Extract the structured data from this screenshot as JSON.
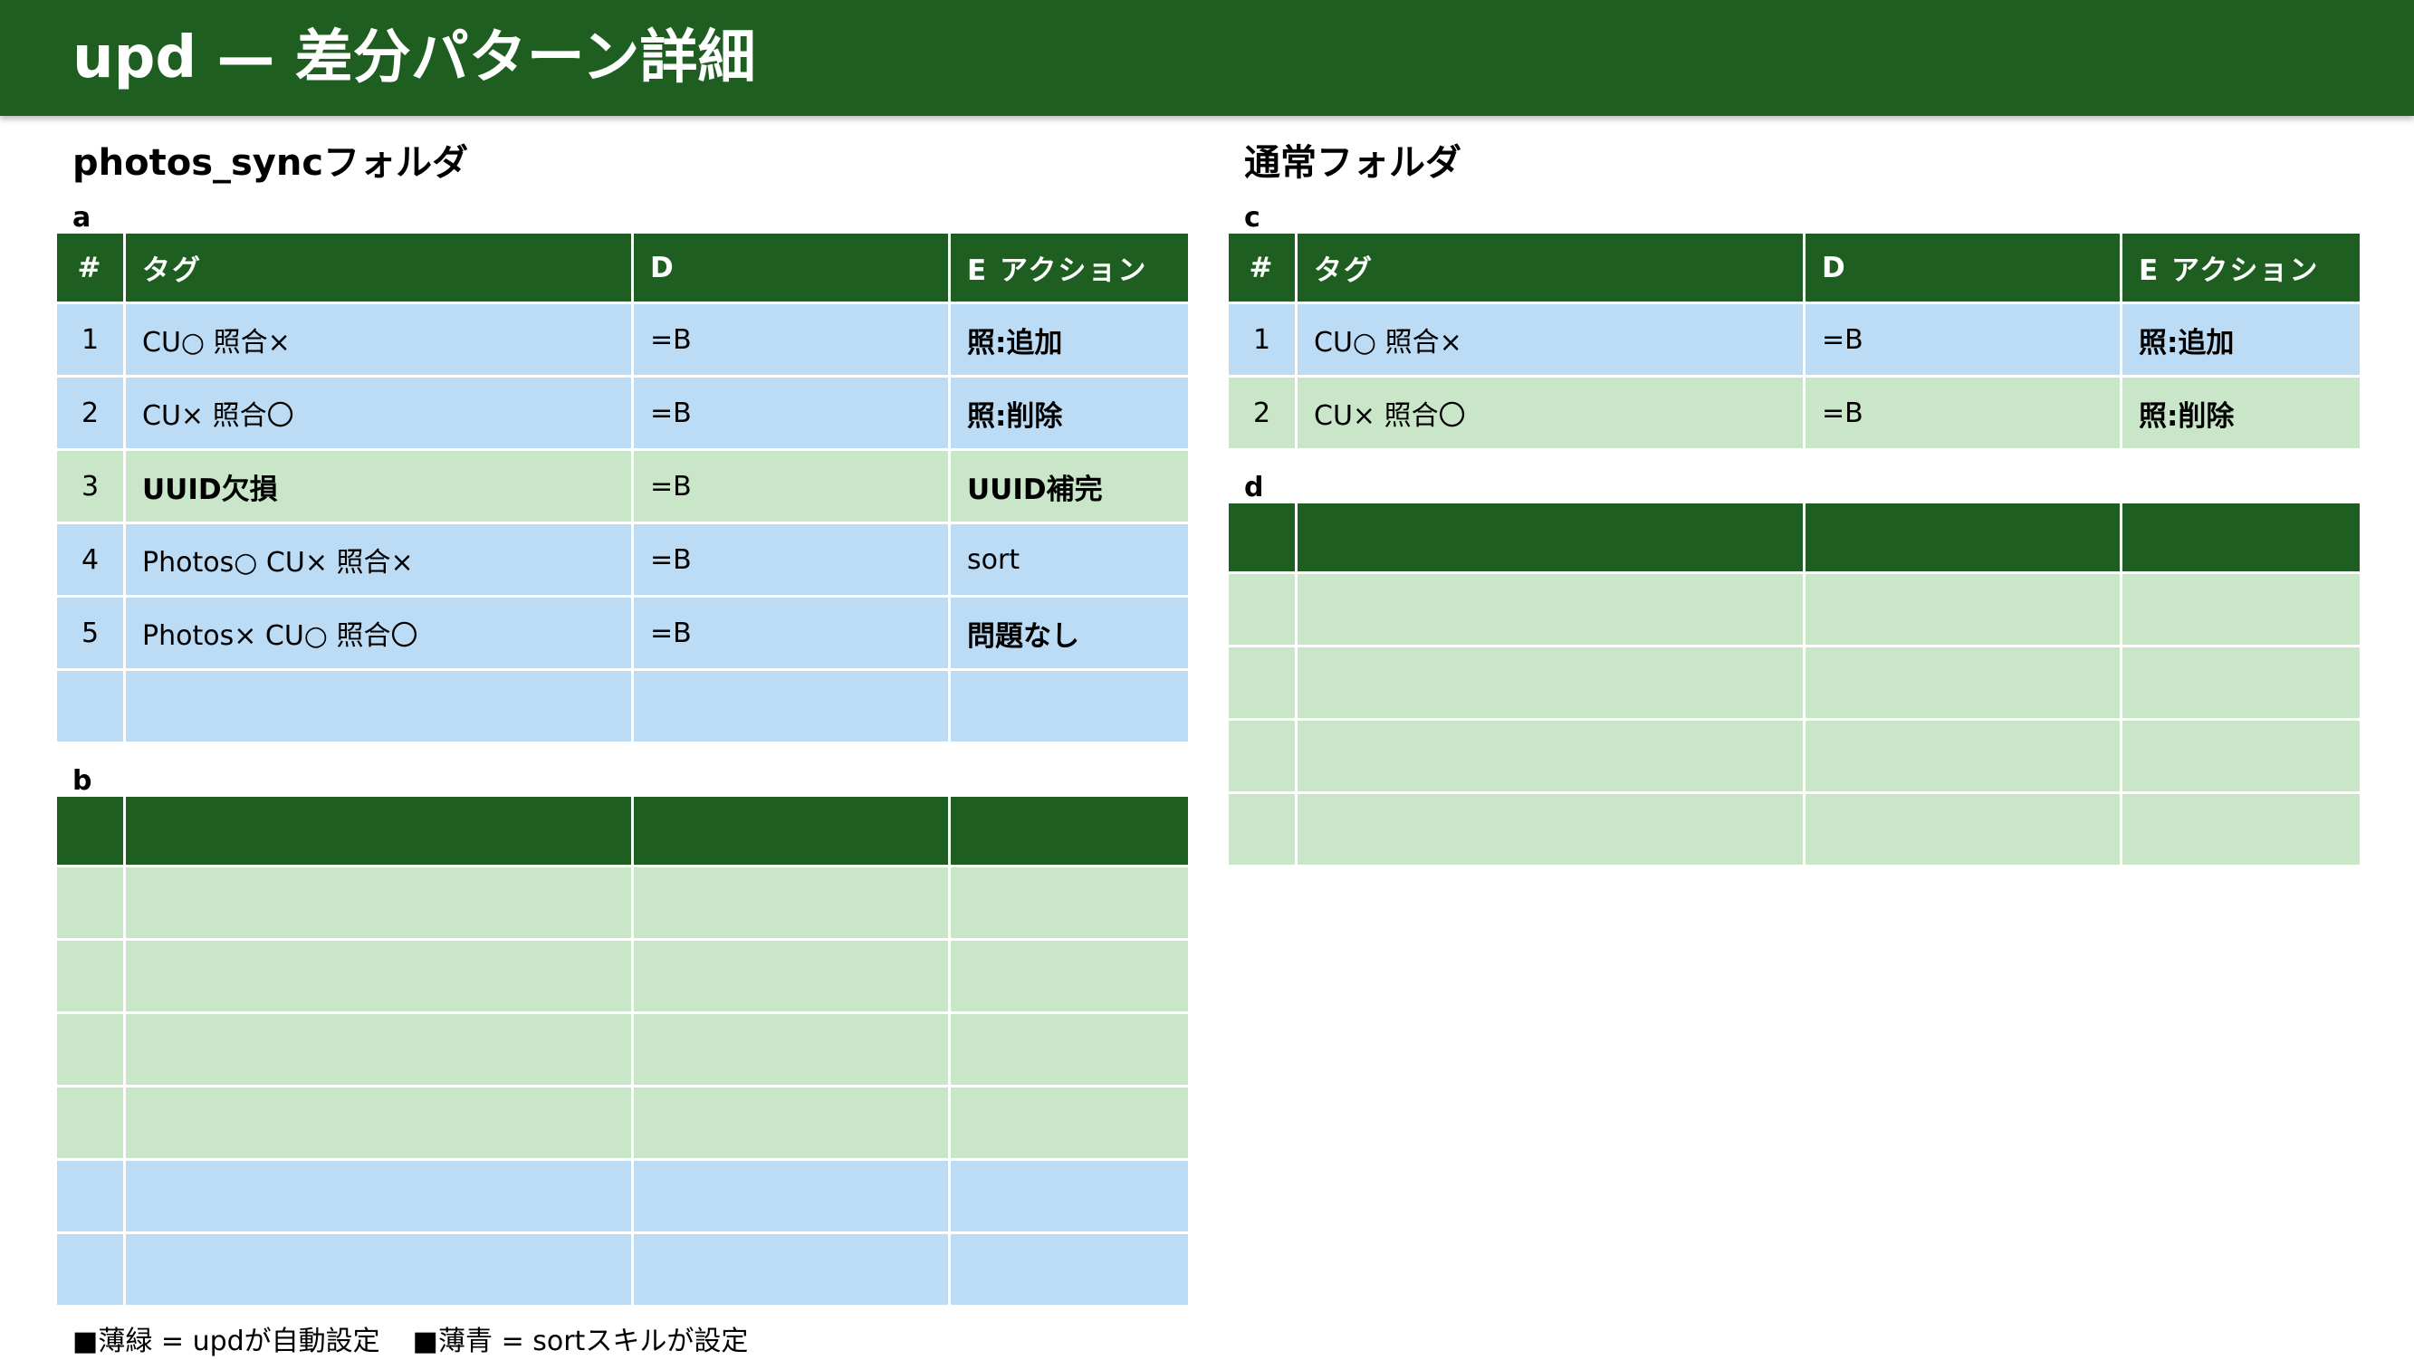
{
  "header": {
    "title": "upd — 差分パターン詳細"
  },
  "left": {
    "title": "photos_syncフォルダ",
    "table_a": {
      "label": "a",
      "columns": [
        "#",
        "タグ",
        "D",
        "E アクション"
      ],
      "rows": [
        {
          "num": "1",
          "tag": "CU○ 照合×",
          "d": "=B",
          "action": "照:追加",
          "color": "blue"
        },
        {
          "num": "2",
          "tag": "CU× 照合〇",
          "d": "=B",
          "action": "照:削除",
          "color": "blue"
        },
        {
          "num": "3",
          "tag": "UUID欠損",
          "d": "=B",
          "action": "UUID補完",
          "color": "green"
        },
        {
          "num": "4",
          "tag": "Photos○ CU× 照合×",
          "d": "=B",
          "action": "sort",
          "color": "blue"
        },
        {
          "num": "5",
          "tag": "Photos× CU○ 照合〇",
          "d": "=B",
          "action": "問題なし",
          "color": "blue"
        },
        {
          "num": "",
          "tag": "",
          "d": "",
          "action": "",
          "color": "blue"
        }
      ]
    },
    "table_b": {
      "label": "b",
      "rows": [
        "green",
        "green",
        "green",
        "green",
        "blue",
        "blue"
      ]
    }
  },
  "right": {
    "title": "通常フォルダ",
    "table_c": {
      "label": "c",
      "columns": [
        "#",
        "タグ",
        "D",
        "E アクション"
      ],
      "rows": [
        {
          "num": "1",
          "tag": "CU○ 照合×",
          "d": "=B",
          "action": "照:追加",
          "color": "blue"
        },
        {
          "num": "2",
          "tag": "CU× 照合〇",
          "d": "=B",
          "action": "照:削除",
          "color": "green"
        }
      ]
    },
    "table_d": {
      "label": "d",
      "rows": [
        "green",
        "green",
        "green",
        "green"
      ]
    }
  },
  "legend": {
    "green_marker": "■",
    "green_text": "薄緑 = updが自動設定",
    "blue_marker": "■",
    "blue_text": "薄青 = sortスキルが設定"
  },
  "colors": {
    "header_green": "#1e5e20",
    "light_green": "#c9e6c9",
    "light_blue": "#bcdcf6"
  }
}
